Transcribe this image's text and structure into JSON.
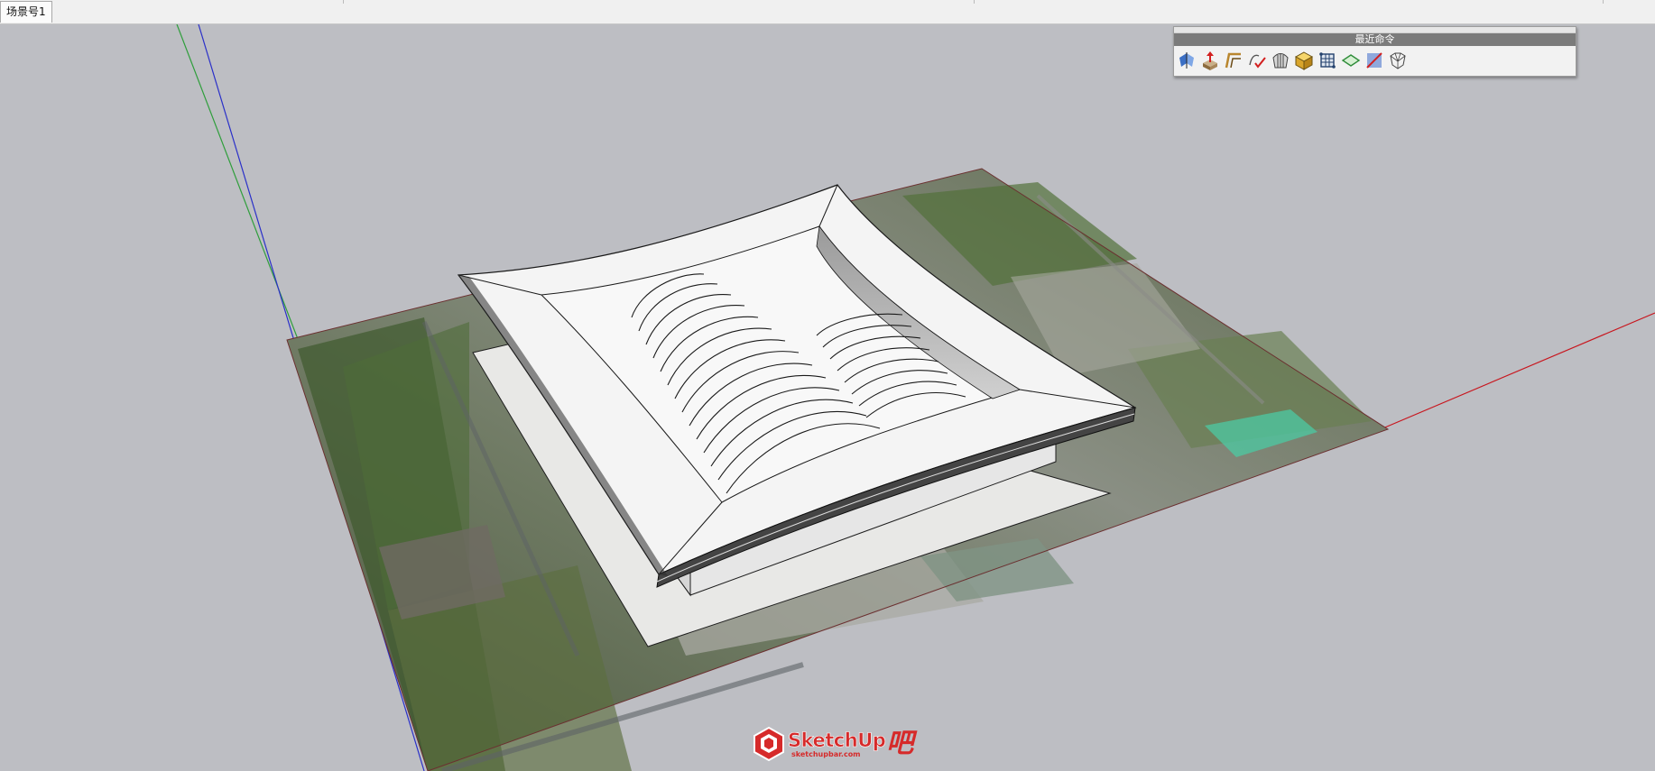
{
  "scene_tabs": [
    {
      "label": "场景号1"
    }
  ],
  "recent_commands": {
    "title": "最近命令",
    "icons": [
      {
        "name": "mirror-wings-icon"
      },
      {
        "name": "push-pull-arrow-icon"
      },
      {
        "name": "offset-edge-icon"
      },
      {
        "name": "check-curve-icon"
      },
      {
        "name": "shell-surface-icon"
      },
      {
        "name": "subdivide-cube-icon"
      },
      {
        "name": "grid-box-icon"
      },
      {
        "name": "green-plane-icon"
      },
      {
        "name": "section-plane-icon"
      },
      {
        "name": "fox-wireframe-icon"
      }
    ]
  },
  "watermark": {
    "brand": "SketchUp",
    "suffix": "吧",
    "url": "sketchupbar.com"
  },
  "colors": {
    "viewport_bg": "#bdbec3",
    "axis_red": "#c8161e",
    "axis_green": "#2f9e3c",
    "axis_blue": "#2a30c8",
    "model_white": "#f4f4f4",
    "brand_red": "#d62a2a"
  }
}
